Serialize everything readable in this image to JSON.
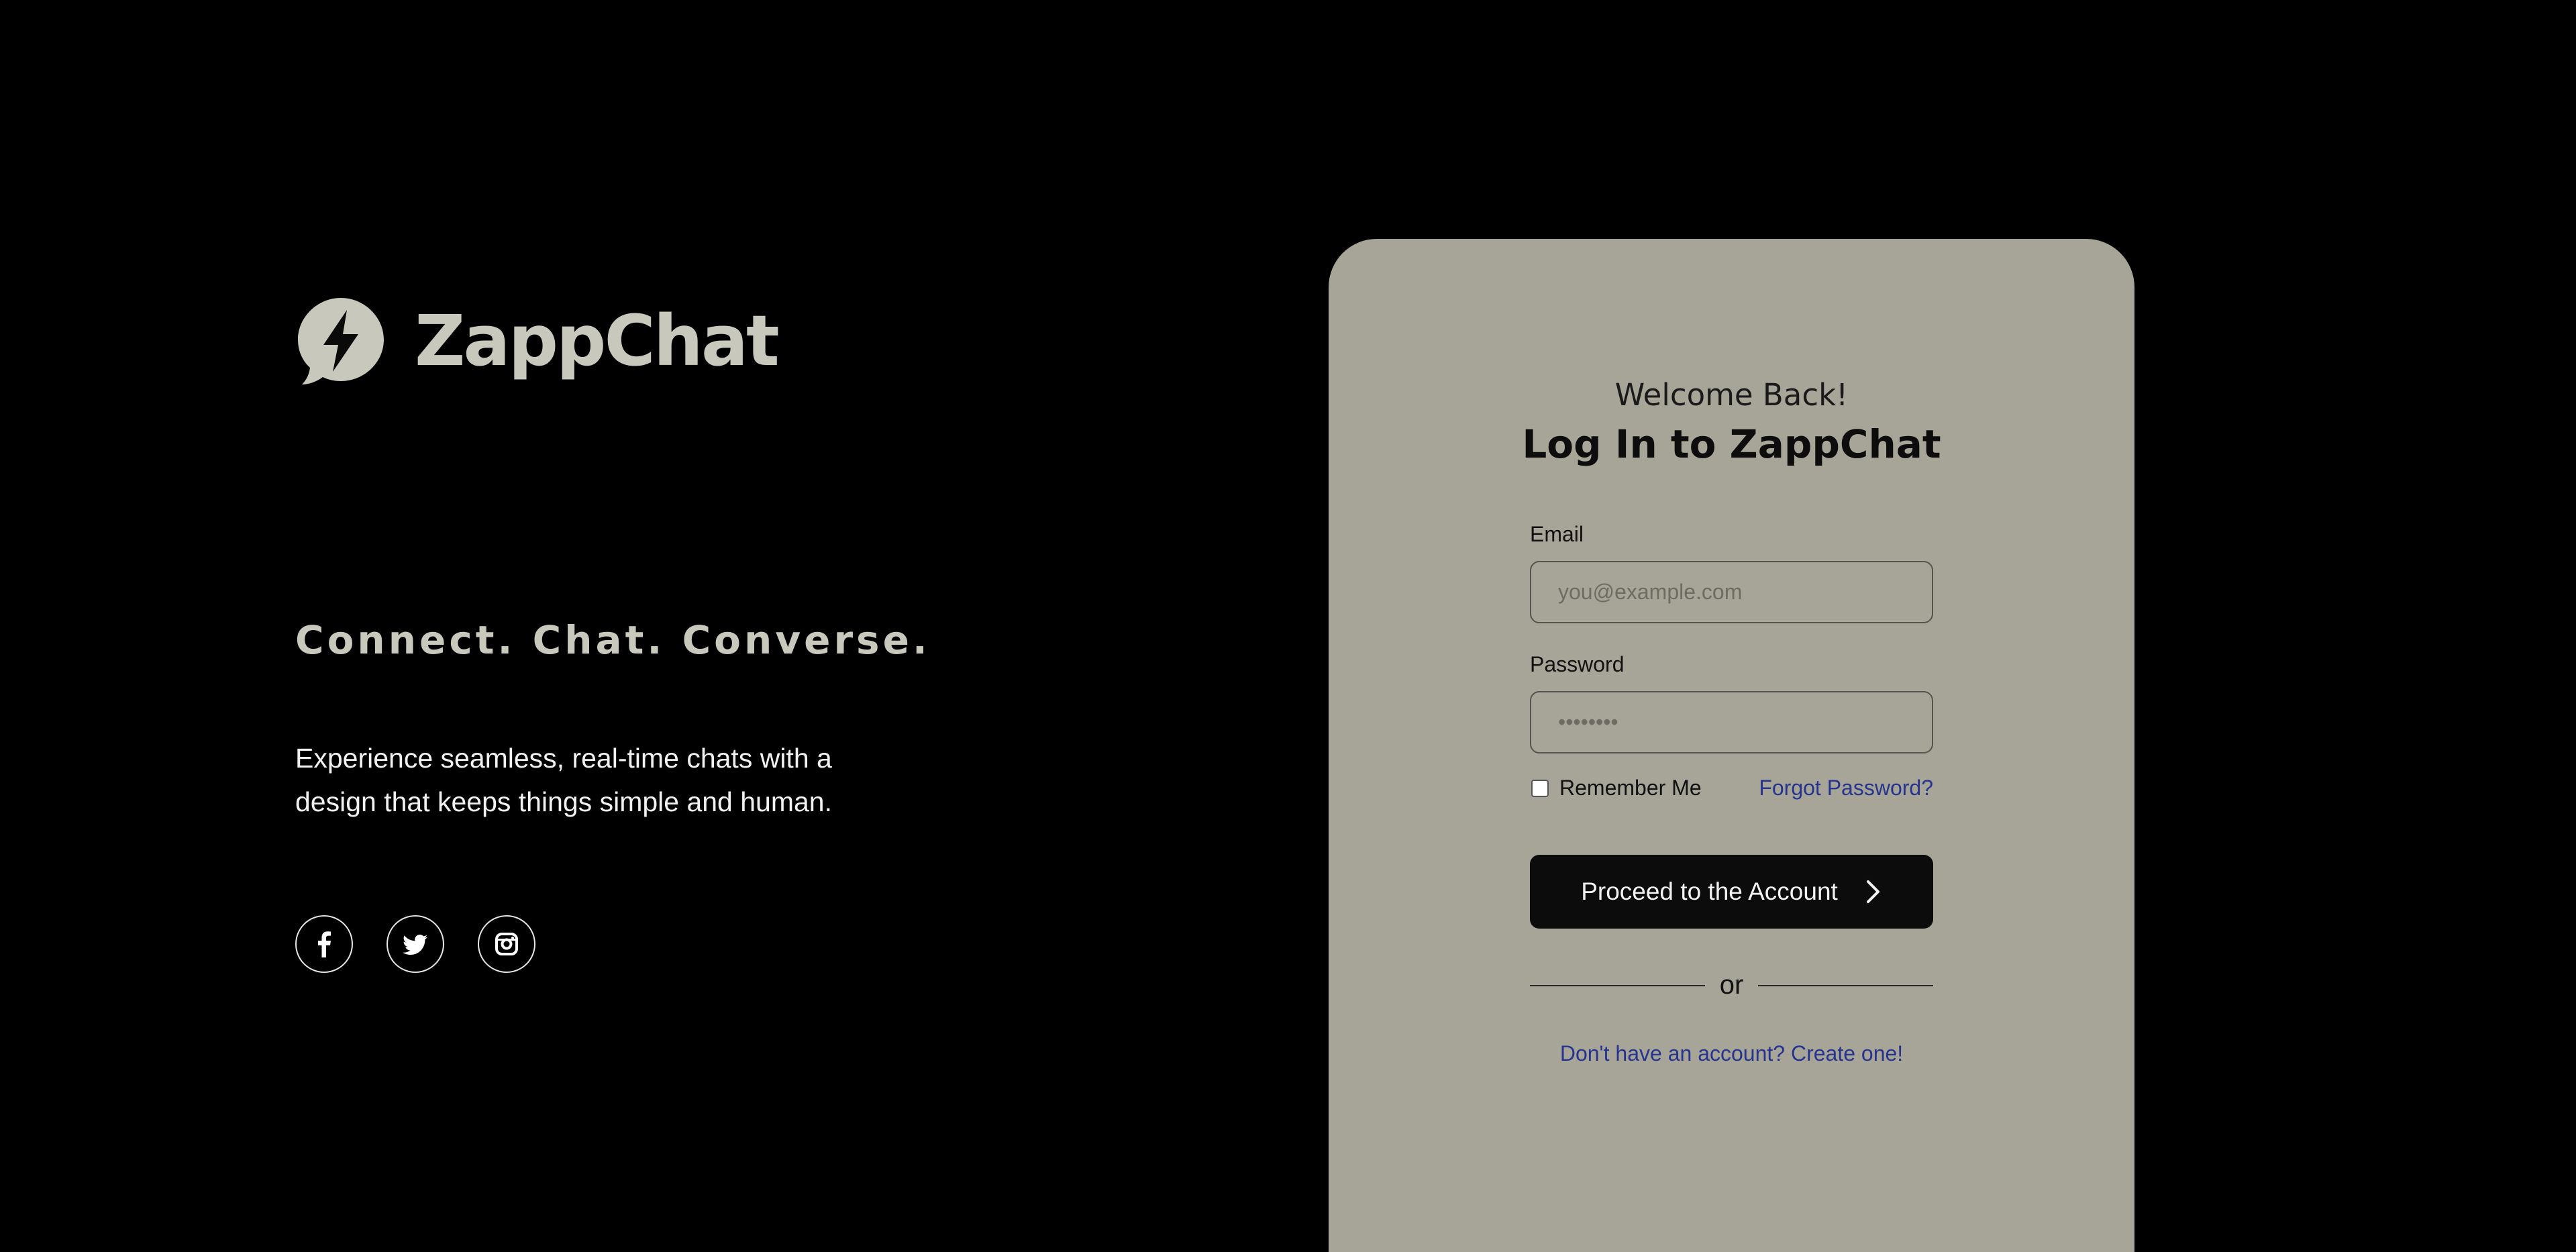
{
  "brand": {
    "name": "ZappChat",
    "logo_icon": "lightning-chat-bubble-icon",
    "color": "#c9c8bc"
  },
  "hero": {
    "tagline": "Connect. Chat. Converse.",
    "description": "Experience seamless, real-time chats with a design that keeps things simple and human."
  },
  "socials": [
    {
      "icon": "facebook-icon"
    },
    {
      "icon": "twitter-icon"
    },
    {
      "icon": "instagram-icon"
    }
  ],
  "login": {
    "welcome": "Welcome Back!",
    "title": "Log In to ZappChat",
    "email": {
      "label": "Email",
      "value": "",
      "placeholder": "you@example.com"
    },
    "password": {
      "label": "Password",
      "value": "",
      "placeholder": "••••••••"
    },
    "remember_label": "Remember Me",
    "remember_checked": false,
    "forgot_label": "Forgot Password?",
    "submit_label": "Proceed to the Account",
    "divider_label": "or",
    "signup_label": "Don't have an account? Create one!"
  },
  "colors": {
    "background": "#000000",
    "card": "#a6a597",
    "button": "#0c0c0c",
    "link": "#26348f"
  }
}
